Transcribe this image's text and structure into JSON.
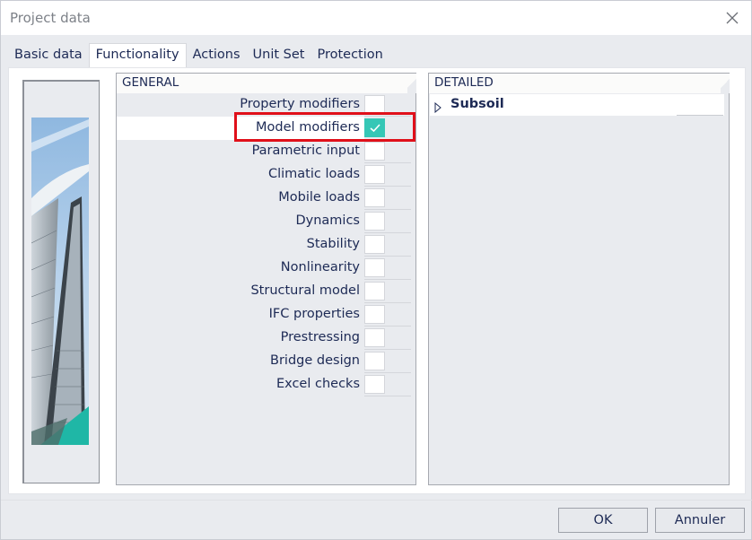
{
  "window": {
    "title": "Project data",
    "close_icon": "close-icon"
  },
  "tabs": [
    {
      "label": "Basic data",
      "active": false
    },
    {
      "label": "Functionality",
      "active": true
    },
    {
      "label": "Actions",
      "active": false
    },
    {
      "label": "Unit Set",
      "active": false
    },
    {
      "label": "Protection",
      "active": false
    }
  ],
  "general": {
    "header": "GENERAL",
    "items": [
      {
        "label": "Property modifiers",
        "checked": false
      },
      {
        "label": "Model modifiers",
        "checked": true
      },
      {
        "label": "Parametric input",
        "checked": false
      },
      {
        "label": "Climatic loads",
        "checked": false
      },
      {
        "label": "Mobile loads",
        "checked": false
      },
      {
        "label": "Dynamics",
        "checked": false
      },
      {
        "label": "Stability",
        "checked": false
      },
      {
        "label": "Nonlinearity",
        "checked": false
      },
      {
        "label": "Structural model",
        "checked": false
      },
      {
        "label": "IFC properties",
        "checked": false
      },
      {
        "label": "Prestressing",
        "checked": false
      },
      {
        "label": "Bridge design",
        "checked": false
      },
      {
        "label": "Excel checks",
        "checked": false
      }
    ]
  },
  "detailed": {
    "header": "DETAILED",
    "items": [
      {
        "label": "Subsoil",
        "expand_icon": "triangle-right-icon"
      }
    ]
  },
  "buttons": {
    "ok": "OK",
    "cancel": "Annuler"
  },
  "colors": {
    "accent": "#35c7b6",
    "highlight": "#e0101a",
    "text": "#1d2a55"
  }
}
